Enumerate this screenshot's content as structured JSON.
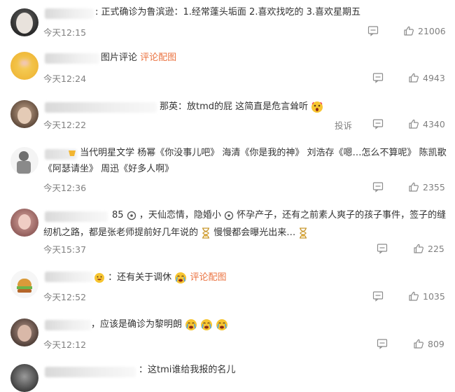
{
  "comments": [
    {
      "text": ": 正式确诊为鲁滨逊：1.经常蓬头垢面 2.喜欢找吃的 3.喜欢星期五",
      "time": "今天12:15",
      "likes": "21006"
    },
    {
      "text": "图片评论",
      "link": "评论配图",
      "time": "今天12:24",
      "likes": "4943"
    },
    {
      "text": "那英：放tmd的屁 这简直是危言耸听",
      "time": "今天12:22",
      "report": "投诉",
      "likes": "4340"
    },
    {
      "line1": "当代明星文学 杨幂《你没事儿吧》 海清《你是我的神》 刘浩存《嗯…怎么不算呢》 陈凯歌",
      "line2": "《阿瑟请坐》 周迅《好多人啊》",
      "time": "今天12:36",
      "likes": "2355"
    },
    {
      "line1": "85",
      "line1b": "，天仙恋情，隐婚小",
      "line1c": "怀孕产子，还有之前素人爽子的孩子事件，签子的缝",
      "line2": "纫机之路，都是张老师提前好几年说的",
      "line2b": "慢慢都会曝光出来…",
      "time": "今天15:37",
      "likes": "225"
    },
    {
      "text": "：还有关于调休",
      "link": "评论配图",
      "time": "今天12:52",
      "likes": "1035"
    },
    {
      "text": "，应该是确诊为黎明朗",
      "time": "今天12:12",
      "likes": "809"
    },
    {
      "text": "：这tmi谁给我报的名儿"
    }
  ],
  "icons": {
    "comment": "comment-icon",
    "like": "thumbs-up-icon"
  }
}
